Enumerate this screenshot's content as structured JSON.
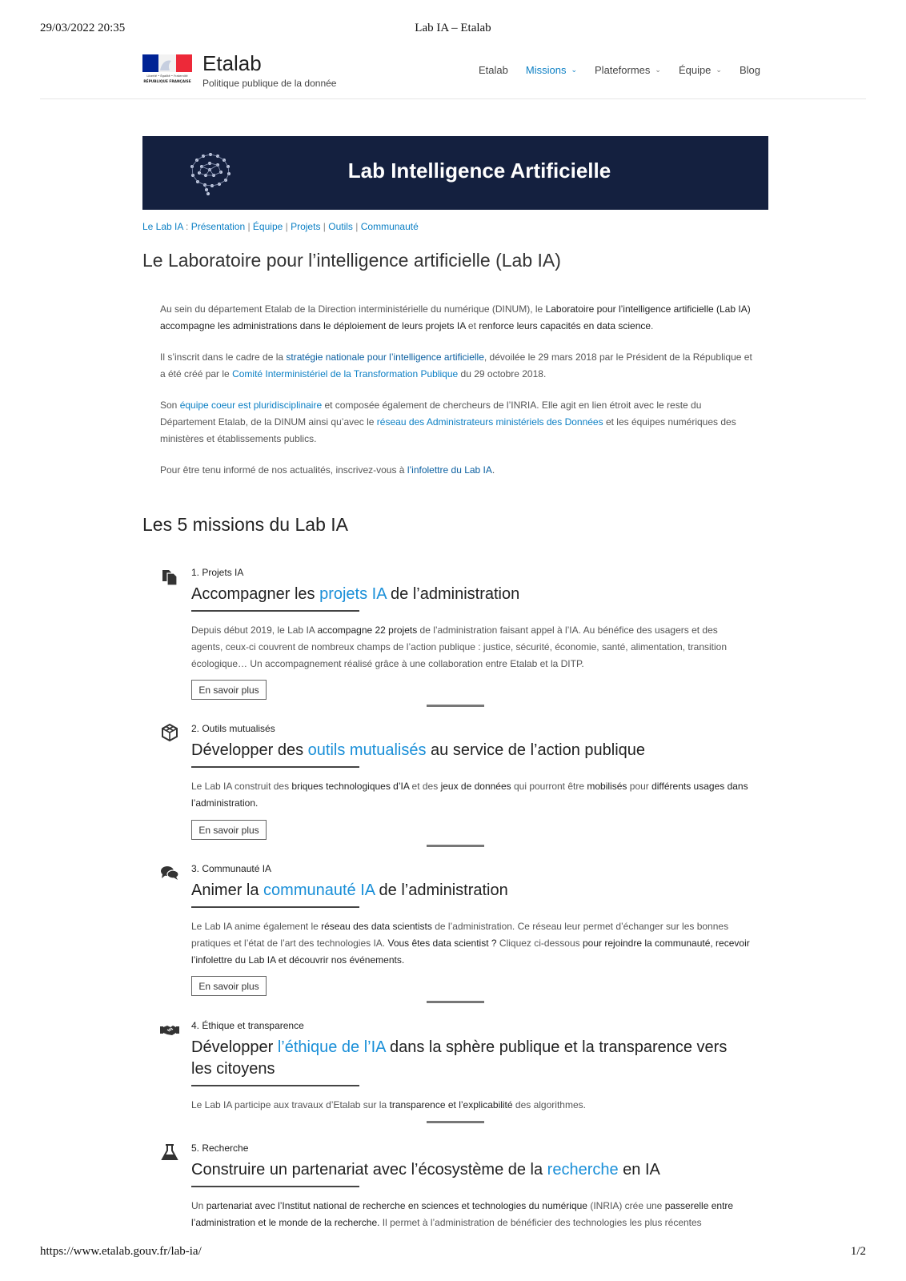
{
  "print": {
    "date": "29/03/2022 20:35",
    "title": "Lab IA – Etalab",
    "url": "https://www.etalab.gouv.fr/lab-ia/",
    "page": "1/2"
  },
  "header": {
    "logo_motto": "Liberté • Égalité • Fraternité",
    "logo_caption": "RÉPUBLIQUE FRANÇAISE",
    "site_name": "Etalab",
    "tagline": "Politique publique de la donnée",
    "nav": [
      {
        "label": "Etalab",
        "dropdown": false,
        "active": false
      },
      {
        "label": "Missions",
        "dropdown": true,
        "active": true
      },
      {
        "label": "Plateformes",
        "dropdown": true,
        "active": false
      },
      {
        "label": "Équipe",
        "dropdown": true,
        "active": false
      },
      {
        "label": "Blog",
        "dropdown": false,
        "active": false
      }
    ]
  },
  "banner": {
    "title": "Lab Intelligence Artificielle"
  },
  "breadcrumb": {
    "root": "Le Lab IA",
    "colon": " : ",
    "links": [
      "Présentation",
      "Équipe",
      "Projets",
      "Outils",
      "Communauté"
    ],
    "separator": " | "
  },
  "page_title": "Le Laboratoire pour l’intelligence artificielle (Lab IA)",
  "intro": {
    "p1": [
      "Au sein du département Etalab de la Direction interministérielle du numérique (DINUM), le ",
      "Laboratoire pour l’intelligence artificielle (Lab IA) accompagne les administrations dans le déploiement de leurs projets IA",
      " et ",
      "renforce leurs capacités en data science",
      "."
    ],
    "p2": [
      "Il s’inscrit dans le cadre de la ",
      "stratégie nationale pour l’intelligence artificielle",
      ", dévoilée le 29 mars 2018 par le Président de la République et a été créé par le ",
      "Comité Interministériel de la Transformation Publique",
      " du 29 octobre 2018."
    ],
    "p3": [
      "Son ",
      "équipe coeur est pluridisciplinaire",
      " et composée également de chercheurs de l’INRIA. Elle agit en lien étroit avec le reste du Département Etalab, de la DINUM ainsi qu’avec le ",
      "réseau des Administrateurs ministériels des Données",
      " et les équipes numériques des ministères et établissements publics."
    ],
    "p4": [
      "Pour être tenu informé de nos actualités, inscrivez-vous à ",
      "l’infolettre du Lab IA",
      "."
    ]
  },
  "missions_heading": "Les 5 missions du Lab IA",
  "missions": [
    {
      "icon": "copy-icon",
      "label": "1. Projets IA",
      "title": [
        "Accompagner les ",
        "projets IA",
        " de l’administration"
      ],
      "body": [
        "Depuis début 2019, le Lab IA ",
        "accompagne 22 projets",
        " de l’administration faisant appel à l’IA. Au bénéfice des usagers et des agents, ceux-ci couvrent de nombreux champs de l’action publique : justice, sécurité, économie, santé, alimentation, transition écologique… Un accompagnement réalisé grâce à une collaboration entre Etalab et la DITP."
      ],
      "button": "En savoir plus"
    },
    {
      "icon": "cube-icon",
      "label": "2. Outils mutualisés",
      "title": [
        "Développer des ",
        "outils mutualisés",
        " au service de l’action publique"
      ],
      "body": [
        "Le Lab IA construit des ",
        "briques technologiques d’IA",
        " et des ",
        "jeux de données",
        " qui pourront être ",
        "mobilisés",
        " pour ",
        "différents usages dans l’administration."
      ],
      "button": "En savoir plus"
    },
    {
      "icon": "comments-icon",
      "label": "3. Communauté IA",
      "title": [
        "Animer la ",
        "communauté IA",
        " de l’administration"
      ],
      "body": [
        "Le Lab IA anime également le ",
        "réseau des data scientists",
        " de l’administration. Ce réseau leur permet d’échanger sur les bonnes pratiques et l’état de l’art des technologies IA. ",
        "Vous êtes data scientist ?",
        " Cliquez ci-dessous ",
        "pour rejoindre la communauté, recevoir l’infolettre du Lab IA et découvrir nos événements."
      ],
      "button": "En savoir plus"
    },
    {
      "icon": "handshake-icon",
      "label": "4. Éthique et transparence",
      "title": [
        "Développer ",
        "l’éthique de l’IA",
        " dans la sphère publique et la transparence vers les citoyens"
      ],
      "body": [
        "Le Lab IA participe aux travaux d’Etalab sur la ",
        "transparence et l’explicabilité",
        " des algorithmes."
      ],
      "button": ""
    },
    {
      "icon": "flask-icon",
      "label": "5. Recherche",
      "title": [
        "Construire un partenariat avec l’écosystème de la ",
        "recherche",
        " en IA"
      ],
      "body": [
        "Un ",
        "partenariat avec l’Institut national de recherche en sciences et technologies du numérique",
        " (INRIA) crée une ",
        "passerelle entre l’administration et le monde de la recherche.",
        " Il permet à l’administration de bénéficier des technologies les plus récentes"
      ],
      "button": ""
    }
  ],
  "colors": {
    "link": "#0b7fc4",
    "banner_bg": "#14203f",
    "flag_blue": "#002395",
    "flag_red": "#ed2939"
  }
}
